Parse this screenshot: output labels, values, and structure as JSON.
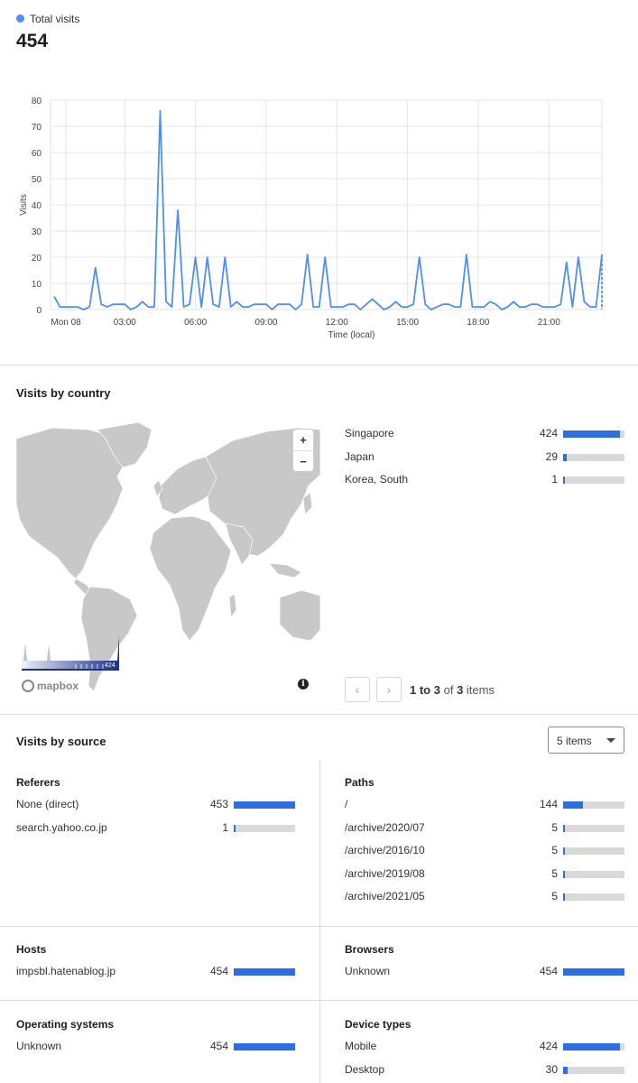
{
  "summary": {
    "legend_label": "Total visits",
    "total": "454",
    "accent": "#4f8ef2"
  },
  "chart_data": {
    "type": "line",
    "xlabel": "Time (local)",
    "ylabel": "Visits",
    "ylim": [
      0,
      80
    ],
    "yticks": [
      0,
      10,
      20,
      30,
      40,
      50,
      60,
      70,
      80
    ],
    "xticks": [
      {
        "t": 0.5,
        "label": "Mon 08"
      },
      {
        "t": 3,
        "label": "03:00"
      },
      {
        "t": 6,
        "label": "06:00"
      },
      {
        "t": 9,
        "label": "09:00"
      },
      {
        "t": 12,
        "label": "12:00"
      },
      {
        "t": 15,
        "label": "15:00"
      },
      {
        "t": 18,
        "label": "18:00"
      },
      {
        "t": 21,
        "label": "21:00"
      }
    ],
    "grid": true,
    "series": [
      {
        "color": "#4f8ef2",
        "x": [
          0,
          0.25,
          0.5,
          0.75,
          1,
          1.25,
          1.5,
          1.75,
          2,
          2.25,
          2.5,
          2.75,
          3,
          3.25,
          3.5,
          3.75,
          4,
          4.25,
          4.5,
          4.75,
          5,
          5.25,
          5.5,
          5.75,
          6,
          6.25,
          6.5,
          6.75,
          7,
          7.25,
          7.5,
          7.75,
          8,
          8.25,
          8.5,
          8.75,
          9,
          9.25,
          9.5,
          9.75,
          10,
          10.25,
          10.5,
          10.75,
          11,
          11.25,
          11.5,
          11.75,
          12,
          12.25,
          12.5,
          12.75,
          13,
          13.25,
          13.5,
          13.75,
          14,
          14.25,
          14.5,
          14.75,
          15,
          15.25,
          15.5,
          15.75,
          16,
          16.25,
          16.5,
          16.75,
          17,
          17.25,
          17.5,
          17.75,
          18,
          18.25,
          18.5,
          18.75,
          19,
          19.25,
          19.5,
          19.75,
          20,
          20.25,
          20.5,
          20.75,
          21,
          21.25,
          21.5,
          21.75,
          22,
          22.25,
          22.5,
          22.75,
          23,
          23.25
        ],
        "y": [
          5,
          1,
          1,
          1,
          1,
          0,
          1,
          16,
          2,
          1,
          2,
          2,
          2,
          0,
          1,
          3,
          1,
          1,
          76,
          3,
          1,
          38,
          1,
          2,
          20,
          1,
          20,
          2,
          1,
          20,
          1,
          3,
          1,
          1,
          2,
          2,
          2,
          0,
          2,
          2,
          2,
          0,
          2,
          21,
          1,
          1,
          20,
          1,
          1,
          1,
          2,
          2,
          0,
          2,
          4,
          2,
          0,
          1,
          3,
          1,
          1,
          2,
          20,
          2,
          0,
          1,
          2,
          2,
          1,
          1,
          21,
          1,
          1,
          1,
          3,
          2,
          0,
          1,
          3,
          1,
          1,
          2,
          2,
          1,
          1,
          1,
          2,
          18,
          1,
          20,
          3,
          1,
          1,
          21
        ],
        "projected_last": 0
      }
    ]
  },
  "countries": {
    "title": "Visits by country",
    "rows": [
      {
        "name": "Singapore",
        "value": "424",
        "frac": 0.93
      },
      {
        "name": "Japan",
        "value": "29",
        "frac": 0.06
      },
      {
        "name": "Korea, South",
        "value": "1",
        "frac": 0.01
      }
    ],
    "map": {
      "zoom_in": "+",
      "zoom_out": "−",
      "scale_min": "0",
      "scale_max": "424",
      "logo": "mapbox",
      "info": "i"
    },
    "pager": {
      "prev": "‹",
      "next": "›",
      "range": "1 to 3",
      "of": "of",
      "total": "3",
      "suffix": "items"
    }
  },
  "sources": {
    "title": "Visits by source",
    "select_value": "5 items",
    "referers": {
      "title": "Referers",
      "rows": [
        {
          "name": "None (direct)",
          "value": "453",
          "frac": 1.0
        },
        {
          "name": "search.yahoo.co.jp",
          "value": "1",
          "frac": 0.01
        }
      ]
    },
    "paths": {
      "title": "Paths",
      "rows": [
        {
          "name": "/",
          "value": "144",
          "frac": 0.32
        },
        {
          "name": "/archive/2020/07",
          "value": "5",
          "frac": 0.01
        },
        {
          "name": "/archive/2016/10",
          "value": "5",
          "frac": 0.01
        },
        {
          "name": "/archive/2019/08",
          "value": "5",
          "frac": 0.01
        },
        {
          "name": "/archive/2021/05",
          "value": "5",
          "frac": 0.01
        }
      ]
    },
    "hosts": {
      "title": "Hosts",
      "rows": [
        {
          "name": "impsbl.hatenablog.jp",
          "value": "454",
          "frac": 1.0
        }
      ]
    },
    "browsers": {
      "title": "Browsers",
      "rows": [
        {
          "name": "Unknown",
          "value": "454",
          "frac": 1.0
        }
      ]
    },
    "os": {
      "title": "Operating systems",
      "rows": [
        {
          "name": "Unknown",
          "value": "454",
          "frac": 1.0
        }
      ]
    },
    "devices": {
      "title": "Device types",
      "rows": [
        {
          "name": "Mobile",
          "value": "424",
          "frac": 0.93
        },
        {
          "name": "Desktop",
          "value": "30",
          "frac": 0.07
        }
      ]
    }
  }
}
